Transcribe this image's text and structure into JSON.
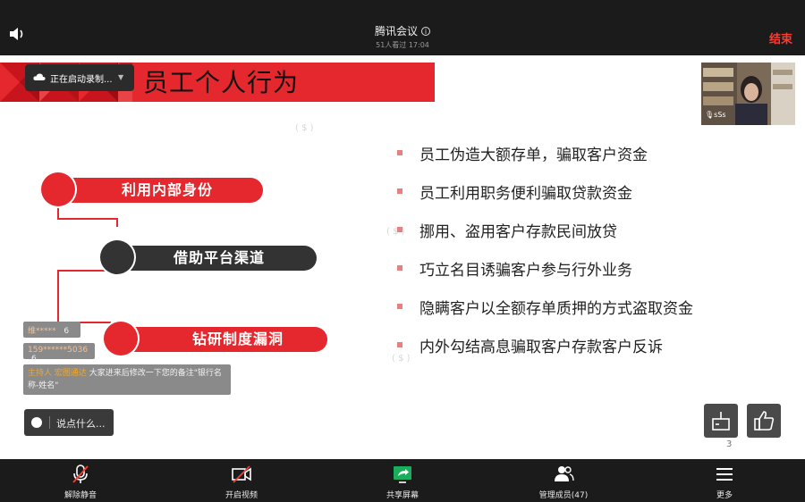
{
  "meeting": {
    "title": "腾讯会议",
    "subtitle": "51人看过  17:04",
    "end_label": "结束"
  },
  "recording": {
    "status": "正在启动录制..."
  },
  "slide": {
    "title": "员工个人行为",
    "flow": [
      "利用内部身份",
      "借助平台渠道",
      "钻研制度漏洞"
    ],
    "bullets": [
      "员工伪造大额存单，骗取客户资金",
      "员工利用职务便利骗取贷款资金",
      "挪用、盗用客户存款民间放贷",
      "巧立名目诱骗客户参与行外业务",
      "隐瞒客户以全额存单质押的方式盗取资金",
      "内外勾结高息骗取客户存款客户反诉"
    ],
    "page_number": "3",
    "colors": {
      "accent": "#e5272e",
      "dark": "#333333"
    }
  },
  "chat": {
    "messages": [
      {
        "user": "维*****",
        "count": "6"
      },
      {
        "user": "159******5036",
        "count": "6"
      },
      {
        "user": "主持人 宏图通达",
        "text": "大家进来后修改一下您的备注\"银行名称-姓名\""
      }
    ],
    "input_placeholder": "说点什么..."
  },
  "participant_video": {
    "name": "sSs"
  },
  "toolbar": {
    "items": [
      {
        "label": "解除静音",
        "icon": "mic-muted-icon"
      },
      {
        "label": "开启视频",
        "icon": "video-off-icon"
      },
      {
        "label": "共享屏幕",
        "icon": "share-screen-icon"
      },
      {
        "label": "管理成员(47)",
        "icon": "members-icon"
      },
      {
        "label": "更多",
        "icon": "more-icon"
      }
    ]
  }
}
